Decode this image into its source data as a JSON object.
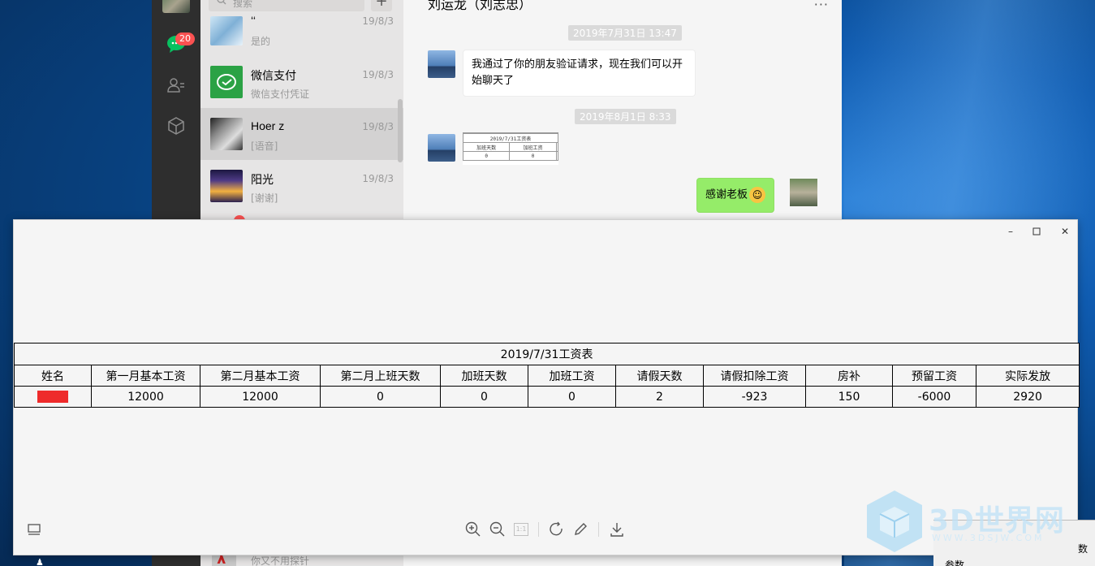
{
  "wechat": {
    "search_placeholder": "搜索",
    "plus_label": "+",
    "unread_badge": "20",
    "chat_list": [
      {
        "name": "&#x2018;&#x2018;",
        "display_name": "‘‘",
        "message": "是的",
        "time": "19/8/3",
        "avatar_color": "#9cc3e0"
      },
      {
        "name": "微信支付",
        "message": "微信支付凭证",
        "time": "19/8/3",
        "avatar_color": "#2ba245"
      },
      {
        "name": "Hoer z",
        "message": "[语音]",
        "time": "19/8/3",
        "avatar_color": "#444444"
      },
      {
        "name": "阳光",
        "message": "[谢谢]",
        "time": "19/8/3",
        "avatar_color": "#3b2b66"
      }
    ],
    "bottom_item_message": "你又不用探针",
    "chat_title": "刘运龙（刘志忠）",
    "more_label": "···",
    "messages": [
      {
        "time": "2019年7月31日 13:47",
        "text": "我通过了你的朋友验证请求，现在我们可以开始聊天了"
      },
      {
        "time": "2019年8月1日 8:33",
        "image_thumb": {
          "title": "2019/7/31工资表",
          "cols": [
            "加班天数",
            "加班工资"
          ],
          "values": [
            "0",
            "0"
          ]
        }
      },
      {
        "text": "感谢老板",
        "emoji": "😂",
        "mine": true
      }
    ]
  },
  "viewer": {
    "controls": {
      "minimize": "–",
      "maximize": "☐",
      "close": "✕"
    },
    "sheet": {
      "title": "2019/7/31工资表",
      "headers": [
        "姓名",
        "第一月基本工资",
        "第二月基本工资",
        "第二月上班天数",
        "加班天数",
        "加班工资",
        "请假天数",
        "请假扣除工资",
        "房补",
        "预留工资",
        "实际发放"
      ],
      "row": [
        "",
        "12000",
        "12000",
        "0",
        "0",
        "0",
        "2",
        "-923",
        "150",
        "-6000",
        "2920"
      ],
      "redacted_color": "#ee2b2b"
    },
    "toolbar": [
      "zoom-in-icon",
      "zoom-out-icon",
      "actual-size-icon",
      "rotate-icon",
      "edit-icon",
      "download-icon"
    ],
    "actual_size_label": "1:1"
  },
  "watermark": {
    "text": "3D世界网",
    "url": "WWW.3DSJW.COM"
  },
  "corner_app": {
    "cell1": "数",
    "cell2": "参数"
  },
  "colors": {
    "wechat_green": "#95ec69",
    "badge_red": "#fa5151",
    "sidebar": "#2e2e2e"
  }
}
